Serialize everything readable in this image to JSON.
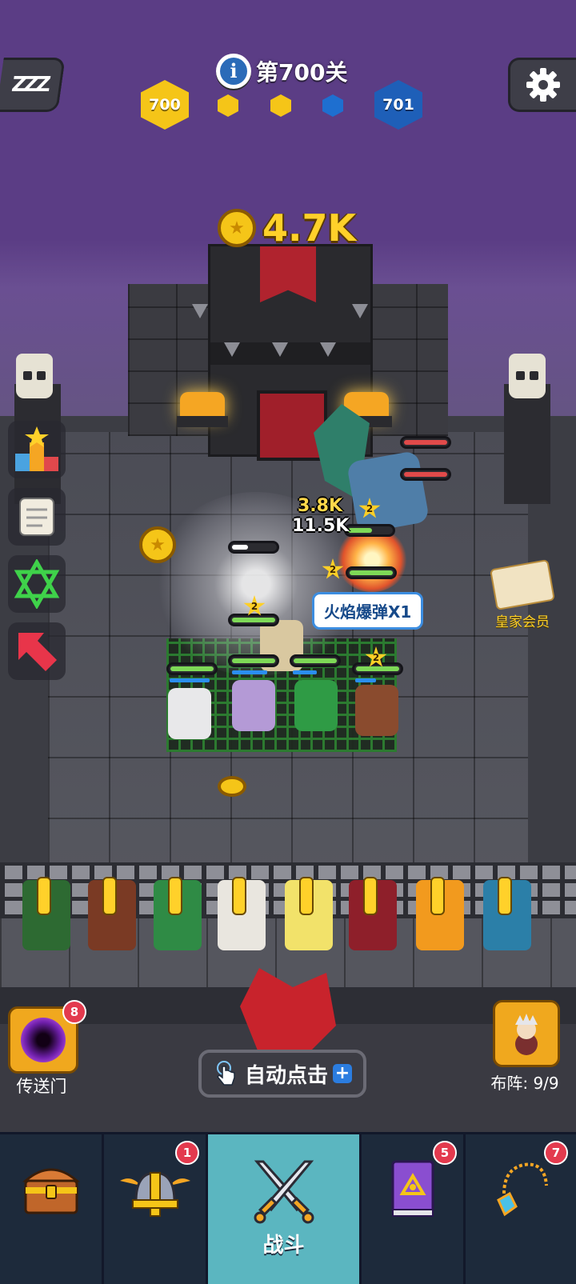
{
  "hud": {
    "level_label": "第700关",
    "current_level": "700",
    "next_level": "701",
    "progress_dots": [
      "#f5c518",
      "#f5c518",
      "#1e6fd0"
    ],
    "coins": "4.7K",
    "sleep_label": "ZZZ"
  },
  "battle": {
    "damage_numbers": [
      "3.8K",
      "11.5K"
    ],
    "skill_popup": "火焰爆弹X1",
    "unit_star_level": "2",
    "royal_member_label": "皇家会员"
  },
  "left_tools": [
    {
      "name": "leaderboard-icon"
    },
    {
      "name": "scroll-icon"
    },
    {
      "name": "hexagram-icon"
    },
    {
      "name": "red-arrow-icon"
    }
  ],
  "bottom": {
    "portal_label": "传送门",
    "portal_badge": "8",
    "auto_click_label": "自动点击",
    "formation_label": "布阵: 9/9"
  },
  "nav": {
    "tabs": [
      {
        "icon": "treasure-chest-icon",
        "badge": ""
      },
      {
        "icon": "viking-helmet-icon",
        "badge": "1"
      },
      {
        "icon": "crossed-swords-icon",
        "label": "战斗",
        "active": true
      },
      {
        "icon": "spellbook-icon",
        "badge": "5"
      },
      {
        "icon": "amulet-icon",
        "badge": "7"
      }
    ],
    "battle_label": "战斗"
  },
  "colors": {
    "sky": "#5b3d85",
    "gold": "#ffd12a",
    "hp_green": "#7ed957",
    "hp_red": "#e04a4a",
    "nav_bg": "#1d2a3b",
    "nav_active": "#5bb6c0"
  }
}
